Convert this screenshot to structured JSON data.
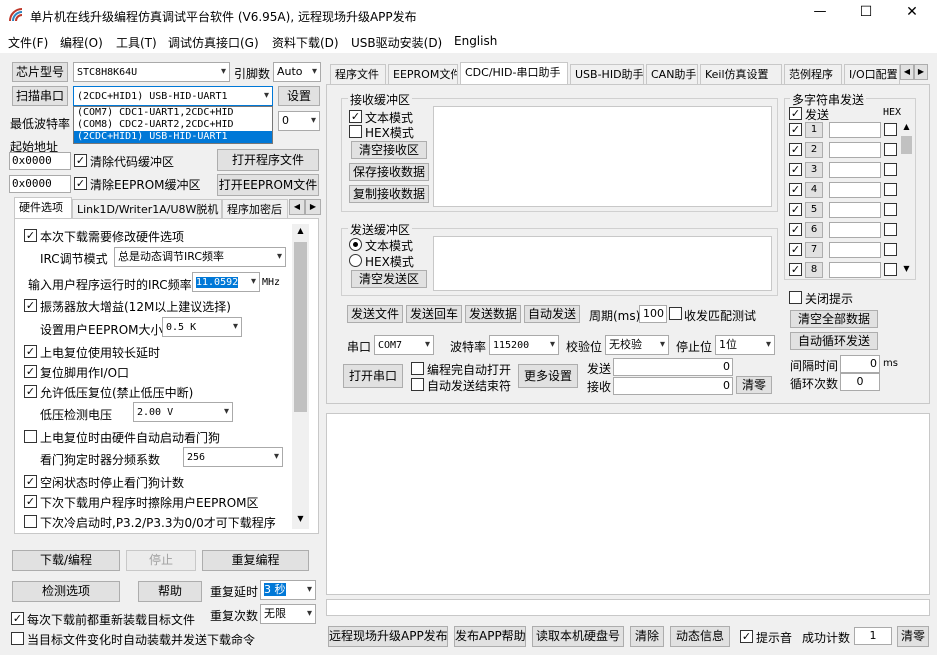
{
  "window": {
    "title": "单片机在线升级编程仿真调试平台软件 (V6.95A), 远程现场升级APP发布",
    "min_label": "—",
    "max_label": "☐",
    "close_label": "✕"
  },
  "menu": [
    "文件(F)",
    "编程(O)",
    "工具(T)",
    "调试仿真接口(G)",
    "资料下载(D)",
    "USB驱动安装(D)",
    "English"
  ],
  "left": {
    "chip_label": "芯片型号",
    "chip_value": "STC8H8K64U",
    "pin_label": "引脚数",
    "pin_value": "Auto",
    "scan_label": "扫描串口",
    "port_value": "(2CDC+HID1) USB-HID-UART1",
    "settings_label": "设置",
    "port_options": [
      "(COM7) CDC1-UART1,2CDC+HID",
      "(COM8) CDC2-UART2,2CDC+HID",
      "(2CDC+HID1) USB-HID-UART1"
    ],
    "min_baud_label": "最低波特率",
    "min_baud_value": "0",
    "start_addr_label": "起始地址",
    "addr1": "0x0000",
    "clear_code_label": "清除代码缓冲区",
    "open_prog_label": "打开程序文件",
    "addr2": "0x0000",
    "clear_eeprom_label": "清除EEPROM缓冲区",
    "open_eeprom_label": "打开EEPROM文件",
    "tabs": [
      "硬件选项",
      "Link1D/Writer1A/U8W脱机",
      "程序加密后"
    ],
    "options": {
      "o1": "本次下载需要修改硬件选项",
      "irc_mode_label": "IRC调节模式",
      "irc_mode_value": "总是动态调节IRC频率",
      "irc_freq_label": "输入用户程序运行时的IRC频率",
      "irc_freq_value": "11.0592",
      "irc_unit": "MHz",
      "o2": "振荡器放大增益(12M以上建议选择)",
      "eeprom_size_label": "设置用户EEPROM大小",
      "eeprom_size_value": "0.5 K",
      "o3": "上电复位使用较长延时",
      "o4": "复位脚用作I/O口",
      "o5": "允许低压复位(禁止低压中断)",
      "lvd_label": "低压检测电压",
      "lvd_value": "2.00 V",
      "o6": "上电复位时由硬件自动启动看门狗",
      "wdt_label": "看门狗定时器分频系数",
      "wdt_value": "256",
      "o7": "空闲状态时停止看门狗计数",
      "o8": "下次下载用户程序时擦除用户EEPROM区",
      "o9": "下次冷启动时,P3.2/P3.3为0/0才可下载程序"
    },
    "download_label": "下载/编程",
    "stop_label": "停止",
    "reprog_label": "重复编程",
    "detect_label": "检测选项",
    "help_label": "帮助",
    "repeat_delay_label": "重复延时",
    "repeat_delay_value": "3 秒",
    "reload_label": "每次下载前都重新装载目标文件",
    "repeat_count_label": "重复次数",
    "repeat_count_value": "无限",
    "auto_label": "当目标文件变化时自动装载并发送下载命令"
  },
  "right": {
    "tabs": [
      "程序文件",
      "EEPROM文件",
      "CDC/HID-串口助手",
      "USB-HID助手",
      "CAN助手",
      "Keil仿真设置",
      "范例程序",
      "I/O口配置"
    ],
    "recv_title": "接收缓冲区",
    "text_mode": "文本模式",
    "hex_mode": "HEX模式",
    "clear_recv": "清空接收区",
    "save_recv": "保存接收数据",
    "copy_recv": "复制接收数据",
    "send_title": "发送缓冲区",
    "clear_send": "清空发送区",
    "send_file": "发送文件",
    "send_enter": "发送回车",
    "send_data": "发送数据",
    "auto_send": "自动发送",
    "period_label": "周期(ms)",
    "period_value": "100",
    "close_match": "收发匹配测试",
    "port_label": "串口",
    "port_value": "COM7",
    "baud_label": "波特率",
    "baud_value": "115200",
    "parity_label": "校验位",
    "parity_value": "无校验",
    "stop_label": "停止位",
    "stop_value": "1位",
    "open_port": "打开串口",
    "auto_open": "编程完自动打开",
    "auto_close": "自动发送结束符",
    "more_settings": "更多设置",
    "send_count_label": "发送",
    "send_count": "0",
    "recv_count_label": "接收",
    "recv_count": "0",
    "clear_count": "清零",
    "multi_title": "多字符串发送",
    "multi_send": "发送",
    "multi_hex": "HEX",
    "multi_rows": [
      "1",
      "2",
      "3",
      "4",
      "5",
      "6",
      "7",
      "8"
    ],
    "close_tip": "关闭提示",
    "clear_all": "清空全部数据",
    "auto_loop": "自动循环发送",
    "interval_label": "间隔时间",
    "interval_value": "0",
    "interval_unit": "ms",
    "loop_label": "循环次数",
    "loop_value": "0"
  },
  "bottom": {
    "upgrade": "远程现场升级APP发布",
    "publish_help": "发布APP帮助",
    "read_disk": "读取本机硬盘号",
    "clear": "清除",
    "dynamic": "动态信息",
    "beep": "提示音",
    "success_label": "成功计数",
    "success_value": "1",
    "clear_count": "清零"
  }
}
